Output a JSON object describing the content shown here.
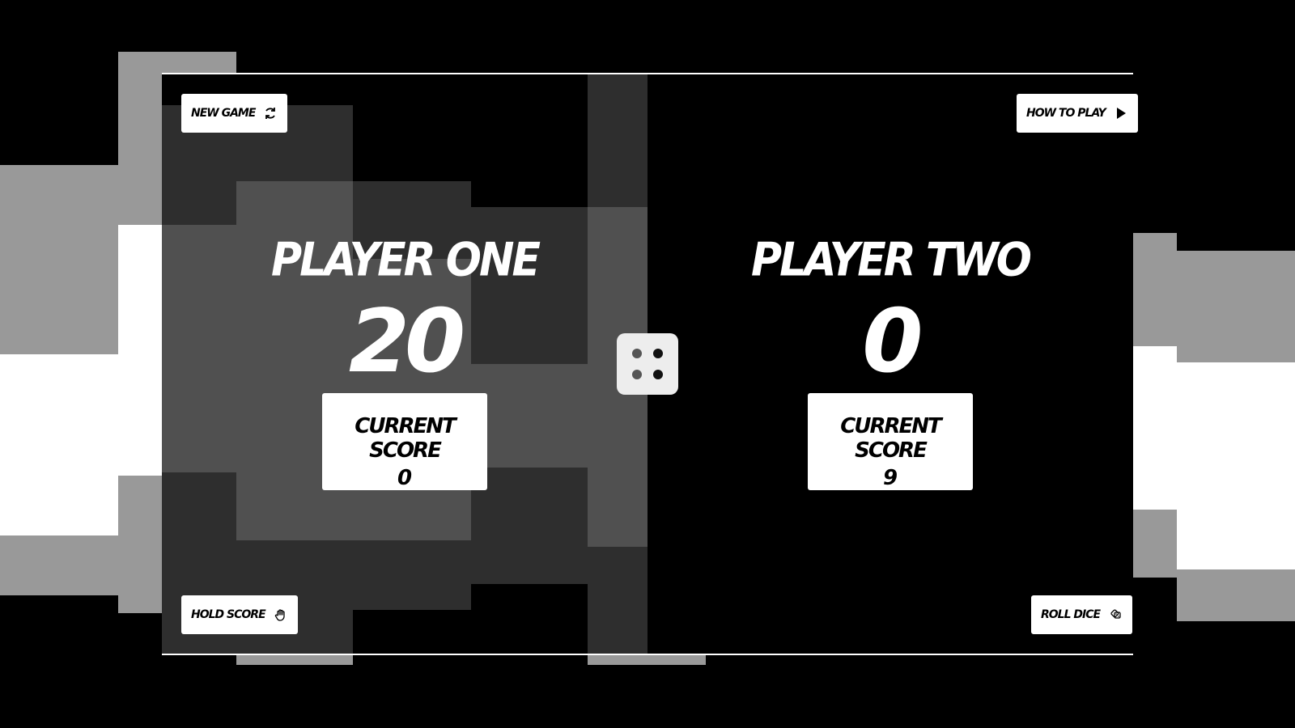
{
  "game": {
    "players": [
      {
        "name": "PLAYER ONE",
        "total_score": "20",
        "current_label": "CURRENT SCORE",
        "current_score": "0",
        "active": true
      },
      {
        "name": "PLAYER TWO",
        "total_score": "0",
        "current_label": "CURRENT SCORE",
        "current_score": "9",
        "active": false
      }
    ],
    "dice": {
      "value": 4
    }
  },
  "buttons": {
    "new_game": "NEW GAME",
    "how_to_play": "HOW TO PLAY",
    "hold_score": "HOLD SCORE",
    "roll_dice": "ROLL DICE"
  },
  "icons": {
    "new_game": "refresh-icon",
    "how_to_play": "play-icon",
    "hold_score": "hand-icon",
    "roll_dice": "dice-icon"
  },
  "colors": {
    "background": "#000000",
    "text": "#ffffff",
    "button_bg": "#ffffff",
    "dice_bg": "#ededed"
  }
}
